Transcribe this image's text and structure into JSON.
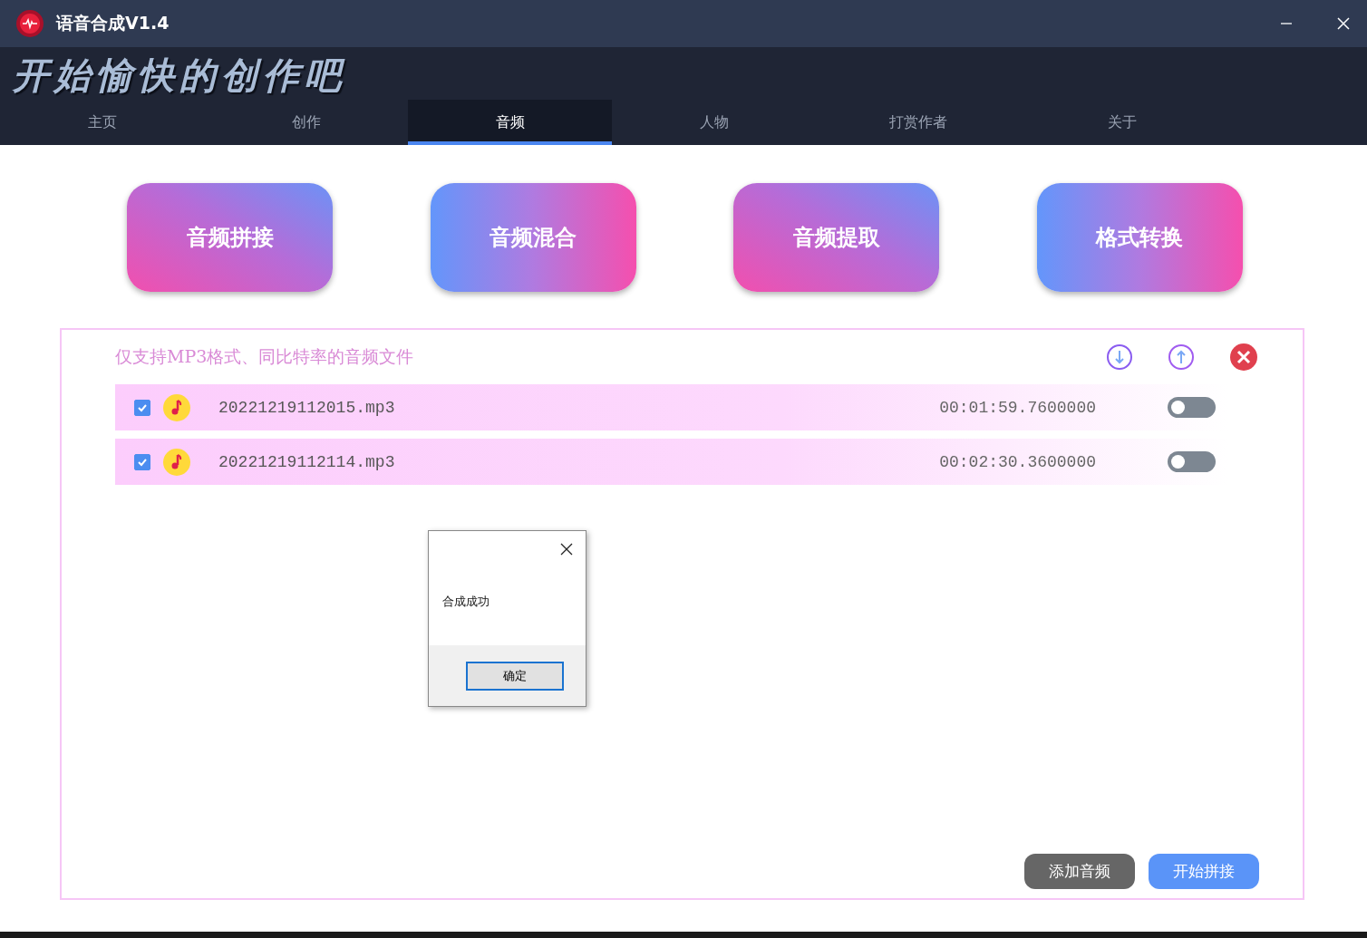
{
  "window": {
    "title": "语音合成V1.4"
  },
  "banner": "开始愉快的创作吧",
  "tabs": [
    {
      "label": "主页",
      "selected": false
    },
    {
      "label": "创作",
      "selected": false
    },
    {
      "label": "音频",
      "selected": true
    },
    {
      "label": "人物",
      "selected": false
    },
    {
      "label": "打赏作者",
      "selected": false
    },
    {
      "label": "关于",
      "selected": false
    }
  ],
  "tools": [
    {
      "label": "音频拼接",
      "kind": "pinkfirst"
    },
    {
      "label": "音频混合",
      "kind": "bluefirst"
    },
    {
      "label": "音频提取",
      "kind": "pinkfirst"
    },
    {
      "label": "格式转换",
      "kind": "bluefirst"
    }
  ],
  "panel": {
    "hint": "仅支持MP3格式、同比特率的音频文件",
    "files": [
      {
        "name": "20221219112015.mp3",
        "duration": "00:01:59.7600000",
        "checked": true,
        "on": false
      },
      {
        "name": "20221219112114.mp3",
        "duration": "00:02:30.3600000",
        "checked": true,
        "on": false
      }
    ],
    "buttons": [
      {
        "label": "添加音频",
        "kind": "secondary"
      },
      {
        "label": "开始拼接",
        "kind": "primary"
      }
    ]
  },
  "dialog": {
    "message": "合成成功",
    "button": "确定"
  }
}
